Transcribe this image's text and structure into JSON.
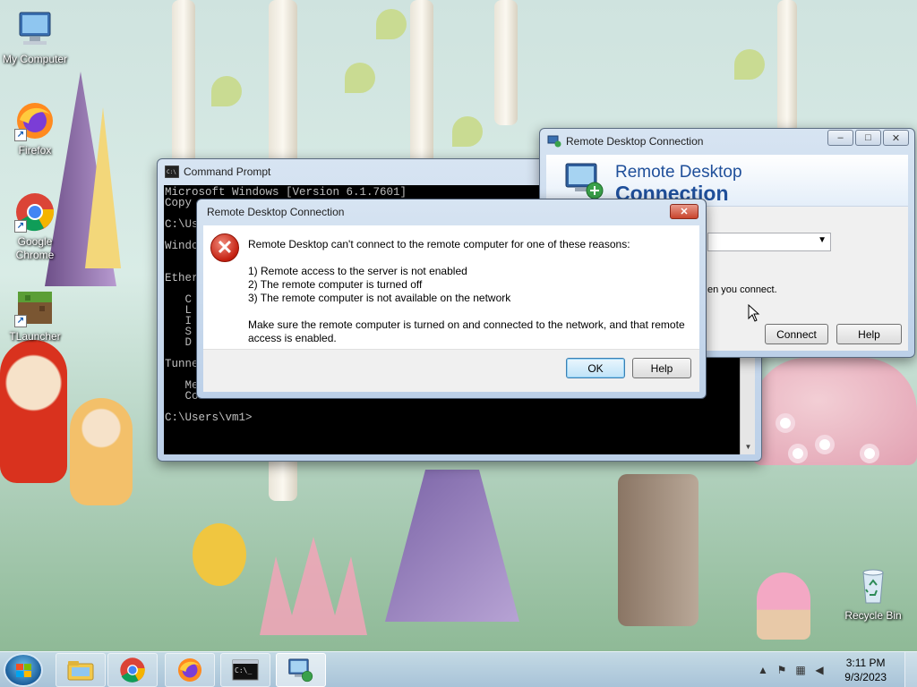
{
  "desktop": {
    "icons": [
      {
        "label": "My Computer",
        "icon": "computer-icon"
      },
      {
        "label": "Firefox",
        "icon": "firefox-icon"
      },
      {
        "label": "Google Chrome",
        "icon": "chrome-icon"
      },
      {
        "label": "TLauncher",
        "icon": "minecraft-icon"
      },
      {
        "label": "Recycle Bin",
        "icon": "recycle-bin-icon"
      }
    ]
  },
  "cmd_window": {
    "title": "Command Prompt",
    "lines": [
      "Microsoft Windows [Version 6.1.7601]",
      "Copy",
      "",
      "C:\\Us",
      "",
      "Windo",
      "",
      "",
      "Ether",
      "",
      "   C",
      "   L",
      "   I",
      "   S",
      "   D",
      "",
      "Tunne",
      "",
      "   Me",
      "   Co",
      "",
      "C:\\Users\\vm1>"
    ]
  },
  "rdc_window": {
    "title": "Remote Desktop Connection",
    "banner_line1": "Remote Desktop",
    "banner_line2": "Connection",
    "partial_text": "en you connect.",
    "connect_label": "Connect",
    "help_label": "Help"
  },
  "error_dialog": {
    "title": "Remote Desktop Connection",
    "intro": "Remote Desktop can't connect to the remote computer for one of these reasons:",
    "reasons": [
      "1) Remote access to the server is not enabled",
      "2) The remote computer is turned off",
      "3) The remote computer is not available on the network"
    ],
    "advice": "Make sure the remote computer is turned on and connected to the network, and that remote access is enabled.",
    "ok_label": "OK",
    "help_label": "Help"
  },
  "taskbar": {
    "items": [
      "windows-explorer-icon",
      "chrome-icon",
      "firefox-icon",
      "command-prompt-icon",
      "remote-desktop-icon"
    ],
    "time": "3:11 PM",
    "date": "9/3/2023"
  }
}
